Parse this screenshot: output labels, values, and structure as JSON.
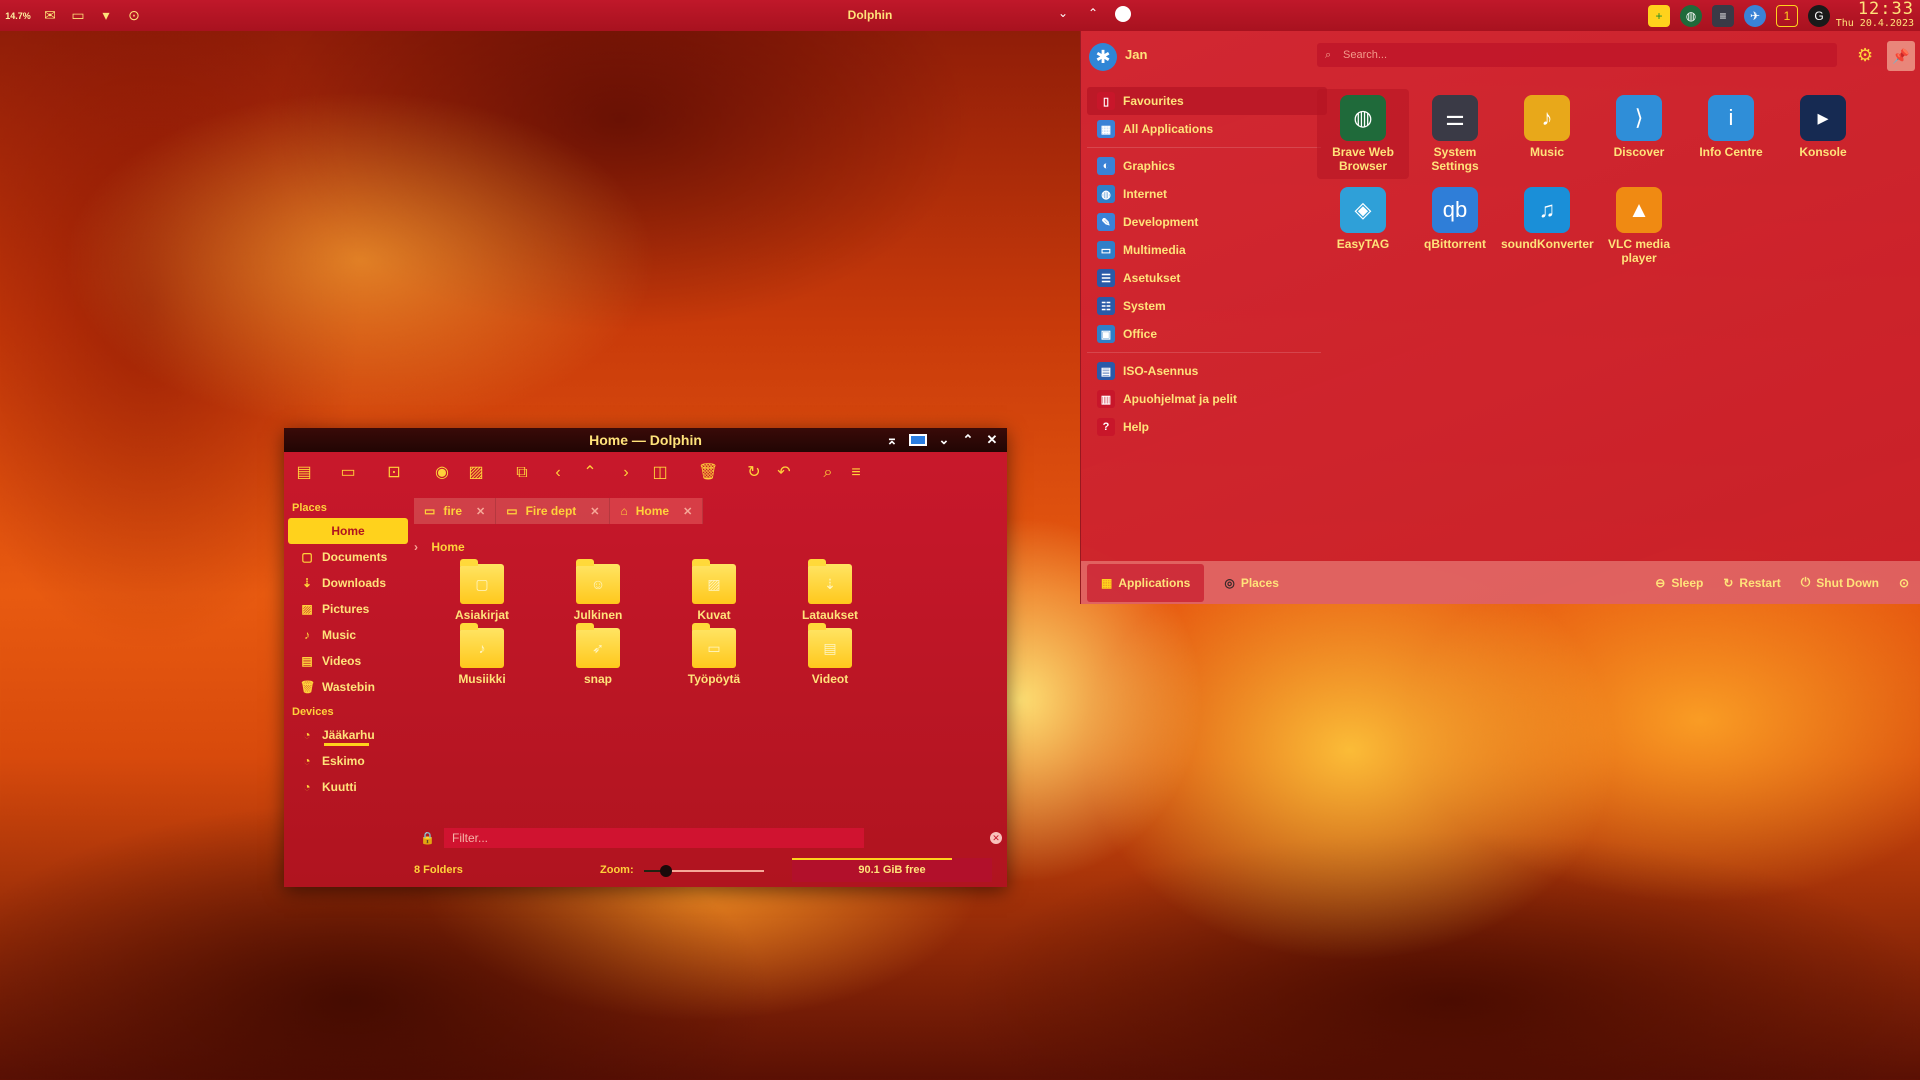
{
  "top_panel": {
    "cpu_label": "14.7%",
    "window_title": "Dolphin",
    "clock_time": "12:33",
    "clock_date": "Thu 20.4.2023"
  },
  "launcher": {
    "user_name": "Jan",
    "search_placeholder": "Search...",
    "categories": [
      {
        "label": "Favourites",
        "icon": "bookmark-icon",
        "color": "#c8162a"
      },
      {
        "label": "All Applications",
        "icon": "grid-icon",
        "color": "#3b82d6"
      },
      {
        "label": "Graphics",
        "icon": "graphics-icon",
        "color": "#3b82d6"
      },
      {
        "label": "Internet",
        "icon": "globe-icon",
        "color": "#2f7fc8"
      },
      {
        "label": "Development",
        "icon": "development-icon",
        "color": "#3b82d6"
      },
      {
        "label": "Multimedia",
        "icon": "monitor-icon",
        "color": "#2f7fc8"
      },
      {
        "label": "Asetukset",
        "icon": "settings-icon",
        "color": "#2a5aa8"
      },
      {
        "label": "System",
        "icon": "system-icon",
        "color": "#2a5aa8"
      },
      {
        "label": "Office",
        "icon": "office-icon",
        "color": "#2f7fc8"
      },
      {
        "label": "ISO-Asennus",
        "icon": "iso-icon",
        "color": "#2a5aa8"
      },
      {
        "label": "Apuohjelmat ja pelit",
        "icon": "utilities-icon",
        "color": "#c8162a"
      },
      {
        "label": "Help",
        "icon": "help-icon",
        "color": "#c8162a"
      }
    ],
    "apps": [
      {
        "label": "Brave Web Browser",
        "icon": "globe-icon",
        "color": "#1f6a3a"
      },
      {
        "label": "System Settings",
        "icon": "system-settings-icon",
        "color": "#3a3a46"
      },
      {
        "label": "Music",
        "icon": "music-icon",
        "color": "#e8a81a"
      },
      {
        "label": "Discover",
        "icon": "discover-icon",
        "color": "#2f8ed8"
      },
      {
        "label": "Info Centre",
        "icon": "info-icon",
        "color": "#2f8ed8"
      },
      {
        "label": "Konsole",
        "icon": "terminal-icon",
        "color": "#162a52"
      },
      {
        "label": "EasyTAG",
        "icon": "tag-icon",
        "color": "#2fa0d8"
      },
      {
        "label": "qBittorrent",
        "icon": "qbittorrent-icon",
        "color": "#2f7ed8"
      },
      {
        "label": "soundKonverter",
        "icon": "soundkonverter-icon",
        "color": "#1a8fd8"
      },
      {
        "label": "VLC media player",
        "icon": "vlc-icon",
        "color": "#f08a12"
      }
    ],
    "footer": {
      "tab_applications": "Applications",
      "tab_places": "Places",
      "sleep": "Sleep",
      "restart": "Restart",
      "shutdown": "Shut Down"
    }
  },
  "dolphin": {
    "title": "Home — Dolphin",
    "places_heading": "Places",
    "places": [
      {
        "label": "Home",
        "icon": "home-icon",
        "active": true
      },
      {
        "label": "Documents",
        "icon": "documents-icon"
      },
      {
        "label": "Downloads",
        "icon": "downloads-icon"
      },
      {
        "label": "Pictures",
        "icon": "pictures-icon"
      },
      {
        "label": "Music",
        "icon": "music-icon"
      },
      {
        "label": "Videos",
        "icon": "videos-icon"
      },
      {
        "label": "Wastebin",
        "icon": "trash-icon"
      }
    ],
    "devices_heading": "Devices",
    "devices": [
      {
        "label": "Jääkarhu",
        "icon": "drive-icon",
        "usage_fraction": 0.75
      },
      {
        "label": "Eskimo",
        "icon": "drive-icon"
      },
      {
        "label": "Kuutti",
        "icon": "drive-icon"
      }
    ],
    "tabs": [
      {
        "label": "fire",
        "icon": "folder-icon"
      },
      {
        "label": "Fire dept",
        "icon": "folder-icon"
      },
      {
        "label": "Home",
        "icon": "home-icon",
        "active": true
      }
    ],
    "breadcrumb": "Home",
    "files": [
      {
        "label": "Asiakirjat",
        "icon": "documents-folder-icon"
      },
      {
        "label": "Julkinen",
        "icon": "public-folder-icon"
      },
      {
        "label": "Kuvat",
        "icon": "pictures-folder-icon"
      },
      {
        "label": "Lataukset",
        "icon": "downloads-folder-icon"
      },
      {
        "label": "Musiikki",
        "icon": "music-folder-icon"
      },
      {
        "label": "snap",
        "icon": "snap-folder-icon"
      },
      {
        "label": "Työpöytä",
        "icon": "desktop-icon"
      },
      {
        "label": "Videot",
        "icon": "videos-folder-icon"
      }
    ],
    "filter_placeholder": "Filter...",
    "status": {
      "folder_count": "8 Folders",
      "zoom_label": "Zoom:",
      "zoom_fraction": 0.18,
      "free_space": "90.1 GiB free",
      "used_fraction": 0.8
    }
  },
  "colors": {
    "panel_red": "#b0121f",
    "accent_yellow": "#ffd21c",
    "text_yellow": "#ffe37a"
  }
}
